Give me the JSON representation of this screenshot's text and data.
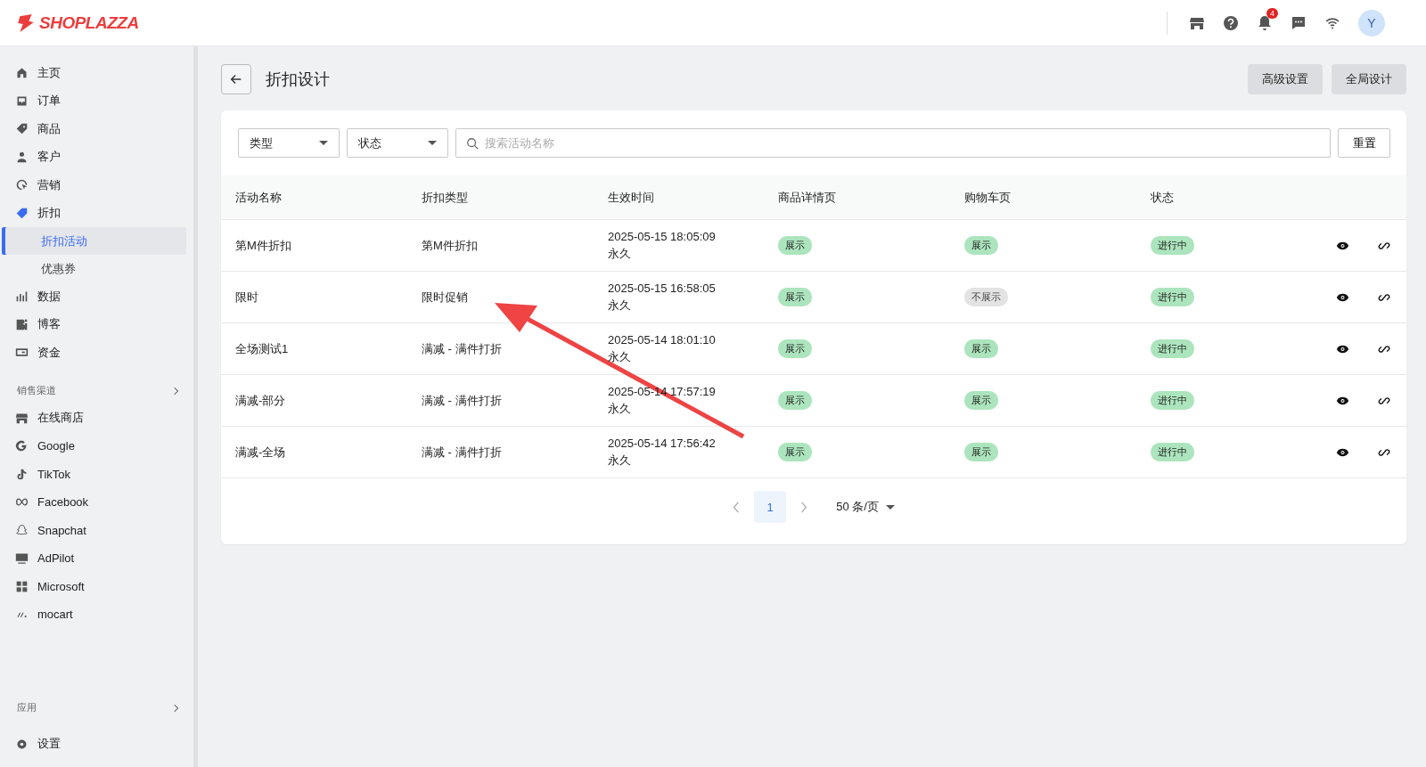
{
  "brand": "SHOPLAZZA",
  "header": {
    "notification_count": "4",
    "avatar": "Y"
  },
  "sidebar": {
    "items": [
      {
        "label": "主页"
      },
      {
        "label": "订单"
      },
      {
        "label": "商品"
      },
      {
        "label": "客户"
      },
      {
        "label": "营销"
      },
      {
        "label": "折扣",
        "children": [
          {
            "label": "折扣活动",
            "selected": true
          },
          {
            "label": "优惠券",
            "selected": false
          }
        ]
      },
      {
        "label": "数据"
      },
      {
        "label": "博客"
      },
      {
        "label": "资金"
      }
    ],
    "channels_heading": "销售渠道",
    "channels": [
      {
        "label": "在线商店"
      },
      {
        "label": "Google"
      },
      {
        "label": "TikTok"
      },
      {
        "label": "Facebook"
      },
      {
        "label": "Snapchat"
      },
      {
        "label": "AdPilot"
      },
      {
        "label": "Microsoft"
      },
      {
        "label": "mocart"
      }
    ],
    "apps_heading": "应用",
    "settings": "设置"
  },
  "page": {
    "title": "折扣设计",
    "buttons": [
      "高级设置",
      "全局设计"
    ]
  },
  "filters": {
    "type": "类型",
    "status": "状态",
    "search_placeholder": "搜索活动名称",
    "reset": "重置"
  },
  "table": {
    "columns": [
      "活动名称",
      "折扣类型",
      "生效时间",
      "商品详情页",
      "购物车页",
      "状态"
    ],
    "rows": [
      {
        "name": "第M件折扣",
        "type": "第M件折扣",
        "time": "2025-05-15 18:05:09",
        "duration": "永久",
        "detail": {
          "text": "展示",
          "shown": true
        },
        "cart": {
          "text": "展示",
          "shown": true
        },
        "status": "进行中"
      },
      {
        "name": "限时",
        "type": "限时促销",
        "time": "2025-05-15 16:58:05",
        "duration": "永久",
        "detail": {
          "text": "展示",
          "shown": true
        },
        "cart": {
          "text": "不展示",
          "shown": false
        },
        "status": "进行中"
      },
      {
        "name": "全场测试1",
        "type": "满减 - 满件打折",
        "time": "2025-05-14 18:01:10",
        "duration": "永久",
        "detail": {
          "text": "展示",
          "shown": true
        },
        "cart": {
          "text": "展示",
          "shown": true
        },
        "status": "进行中"
      },
      {
        "name": "满减-部分",
        "type": "满减 - 满件打折",
        "time": "2025-05-14 17:57:19",
        "duration": "永久",
        "detail": {
          "text": "展示",
          "shown": true
        },
        "cart": {
          "text": "展示",
          "shown": true
        },
        "status": "进行中"
      },
      {
        "name": "满减-全场",
        "type": "满减 - 满件打折",
        "time": "2025-05-14 17:56:42",
        "duration": "永久",
        "detail": {
          "text": "展示",
          "shown": true
        },
        "cart": {
          "text": "展示",
          "shown": true
        },
        "status": "进行中"
      }
    ]
  },
  "pagination": {
    "pages": [
      {
        "label": "1",
        "selected": true
      }
    ],
    "page_size": "50 条/页"
  }
}
